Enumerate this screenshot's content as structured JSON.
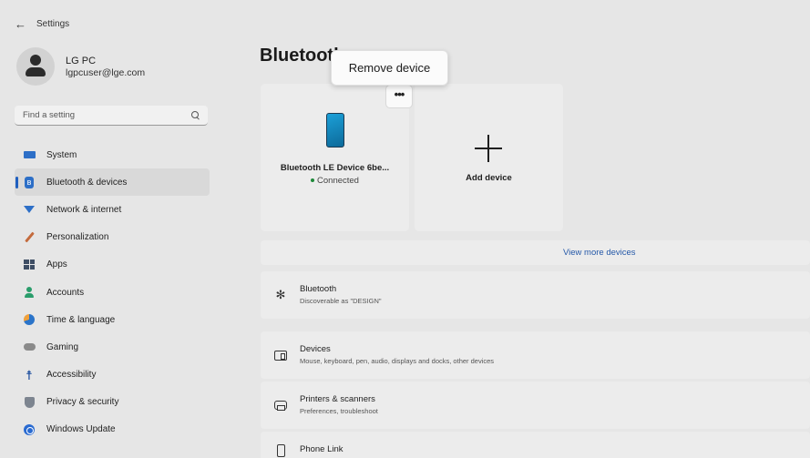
{
  "window": {
    "title": "Settings"
  },
  "profile": {
    "name": "LG PC",
    "email": "lgpcuser@lge.com"
  },
  "search": {
    "placeholder": "Find a setting"
  },
  "nav": {
    "items": [
      {
        "label": "System",
        "icon": "system-icon"
      },
      {
        "label": "Bluetooth & devices",
        "icon": "bluetooth-icon",
        "active": true
      },
      {
        "label": "Network & internet",
        "icon": "network-icon"
      },
      {
        "label": "Personalization",
        "icon": "personalization-icon"
      },
      {
        "label": "Apps",
        "icon": "apps-icon"
      },
      {
        "label": "Accounts",
        "icon": "accounts-icon"
      },
      {
        "label": "Time & language",
        "icon": "time-language-icon"
      },
      {
        "label": "Gaming",
        "icon": "gaming-icon"
      },
      {
        "label": "Accessibility",
        "icon": "accessibility-icon"
      },
      {
        "label": "Privacy & security",
        "icon": "privacy-icon"
      },
      {
        "label": "Windows Update",
        "icon": "windows-update-icon"
      }
    ]
  },
  "main": {
    "title": "Bluetooth",
    "tooltip": "Remove device",
    "more_button": "•••",
    "device": {
      "name": "Bluetooth LE Device 6be...",
      "status": "Connected",
      "icon": "phone-device-icon"
    },
    "add_device": {
      "label": "Add device",
      "icon": "plus-icon"
    },
    "view_more": "View more devices",
    "rows": [
      {
        "title": "Bluetooth",
        "subtitle": "Discoverable as \"DESIGN\"",
        "icon": "bluetooth-symbol-icon"
      },
      {
        "title": "Devices",
        "subtitle": "Mouse, keyboard, pen, audio, displays and docks, other devices",
        "icon": "devices-icon"
      },
      {
        "title": "Printers & scanners",
        "subtitle": "Preferences, troubleshoot",
        "icon": "printer-icon"
      },
      {
        "title": "Phone Link",
        "subtitle": "",
        "icon": "phone-link-icon"
      }
    ]
  },
  "colors": {
    "accent": "#1f5fbf",
    "link": "#2458a8",
    "connected": "#1f8a3a"
  }
}
